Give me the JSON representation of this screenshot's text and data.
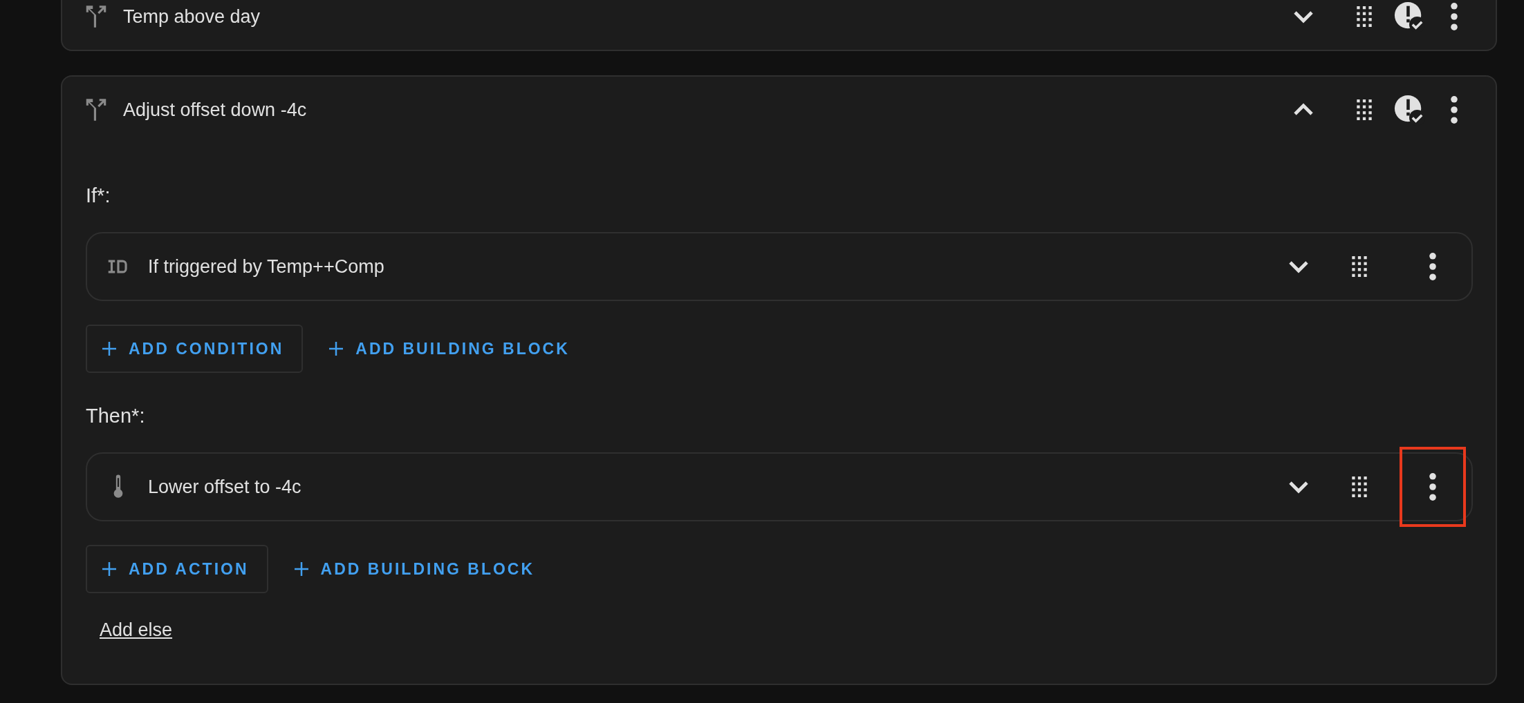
{
  "blocks": [
    {
      "kind": "choose",
      "title": "Temp above day",
      "expanded": false
    },
    {
      "kind": "choose",
      "title": "Adjust offset down -4c",
      "expanded": true,
      "sections": [
        {
          "label": "If*:",
          "items": [
            {
              "kind": "trigger_id",
              "title": "If triggered by Temp++Comp",
              "expanded": false,
              "highlighted": false
            }
          ],
          "buttons": [
            {
              "label": "ADD CONDITION",
              "outlined": true
            },
            {
              "label": "ADD BUILDING BLOCK",
              "outlined": false
            }
          ]
        },
        {
          "label": "Then*:",
          "items": [
            {
              "kind": "thermometer",
              "title": "Lower offset to -4c",
              "expanded": false,
              "highlighted": true
            }
          ],
          "buttons": [
            {
              "label": "ADD ACTION",
              "outlined": true
            },
            {
              "label": "ADD BUILDING BLOCK",
              "outlined": false
            }
          ]
        }
      ],
      "link": "Add else"
    }
  ]
}
